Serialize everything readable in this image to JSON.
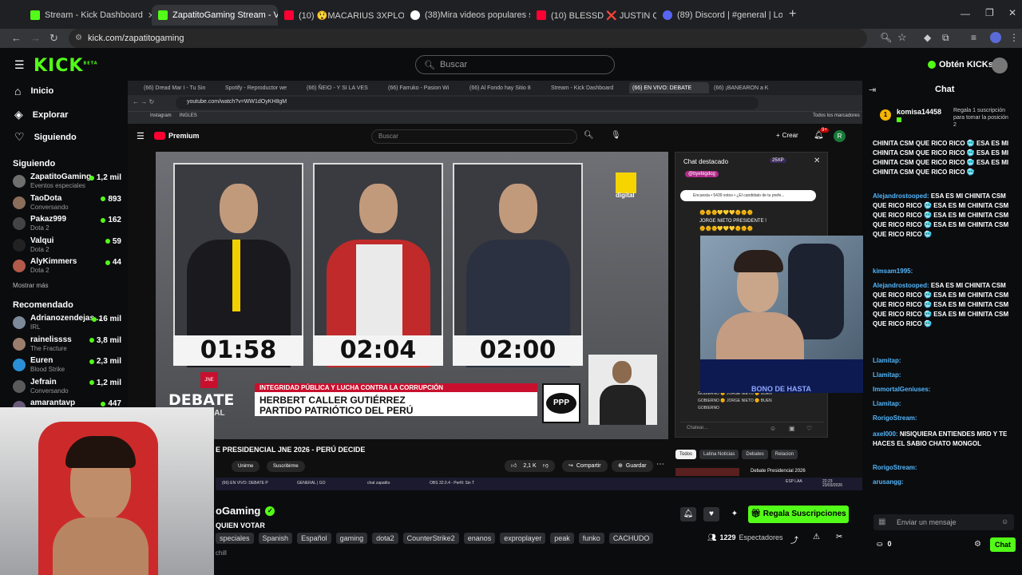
{
  "browser": {
    "tabs": [
      {
        "label": "Stream - Kick Dashboard",
        "color": "#53fc18"
      },
      {
        "label": "ZapatitoGaming Stream - V",
        "color": "#53fc18"
      },
      {
        "label": "(10) 😲MACARIUS 3XPLOTO y",
        "color": "#ff0033"
      },
      {
        "label": "(38)Mira videos populares sele",
        "color": "#ffffff"
      },
      {
        "label": "(10) BLESSD ❌ JUSTIN QUILES",
        "color": "#ff0033"
      },
      {
        "label": "(89) Discord | #general | Lo",
        "color": "#5865f2"
      }
    ],
    "new_tab": "+",
    "url": "kick.com/zapatitogaming"
  },
  "kick": {
    "logo": "KICK",
    "logo_sup": "BETA",
    "search_placeholder": "Buscar",
    "kicks_button": "Obtén KICKs",
    "nav": [
      {
        "label": "Inicio",
        "icon": "home-icon"
      },
      {
        "label": "Explorar",
        "icon": "compass-icon"
      },
      {
        "label": "Siguiendo",
        "icon": "heart-icon"
      }
    ],
    "following_header": "Siguiendo",
    "following": [
      {
        "name": "ZapatitoGaming",
        "sub": "Eventos especiales",
        "viewers": "1,2 mil",
        "color": "#6f6f6f"
      },
      {
        "name": "TaoDota",
        "sub": "Conversando",
        "viewers": "893",
        "color": "#8a6d5a"
      },
      {
        "name": "Pakaz999",
        "sub": "Dota 2",
        "viewers": "162",
        "color": "#444"
      },
      {
        "name": "Valqui",
        "sub": "Dota 2",
        "viewers": "59",
        "color": "#222"
      },
      {
        "name": "AlyKimmers",
        "sub": "Dota 2",
        "viewers": "44",
        "color": "#b45a4a"
      }
    ],
    "show_more": "Mostrar más",
    "recommended_header": "Recomendado",
    "recommended": [
      {
        "name": "Adrianozendejas...",
        "sub": "IRL",
        "viewers": "16 mil",
        "color": "#7d8a9a"
      },
      {
        "name": "rainelissss",
        "sub": "The Fracture",
        "viewers": "3,8 mil",
        "color": "#9a7d6a"
      },
      {
        "name": "Euren",
        "sub": "Blood Strike",
        "viewers": "2,3 mil",
        "color": "#2a8fd6"
      },
      {
        "name": "Jefrain",
        "sub": "Conversando",
        "viewers": "1,2 mil",
        "color": "#5a5a5a"
      },
      {
        "name": "amarantavp",
        "sub": "",
        "viewers": "447",
        "color": "#6a5a7a"
      }
    ],
    "stream": {
      "channel_partial": "oGaming",
      "title_partial": "QUIEN VOTAR",
      "tags": [
        "speciales",
        "Spanish",
        "Español",
        "gaming",
        "dota2",
        "CounterStrike2",
        "enanos",
        "exproplayer",
        "peak",
        "funko",
        "CACHUDO"
      ],
      "subs_button": "Regala Suscripciones",
      "viewers": "1229",
      "viewers_label": "Espectadores",
      "footer_partial": "chill"
    },
    "chat": {
      "title": "Chat",
      "pinned_user": "komisa14458",
      "pinned_text": "Regala 1 suscripción para tomar la posición 2",
      "pinned_rank": "1",
      "input_placeholder": "Enviar un mensaje",
      "count": "0",
      "send_button": "Chat",
      "messages": [
        {
          "user": "",
          "text": "CHINITA CSM QUE RICO RICO 🥶 ESA ES MI CHINITA CSM QUE RICO RICO 🥶 ESA ES MI CHINITA CSM QUE RICO RICO 🥶 ESA ES MI CHINITA CSM QUE RICO RICO 🥶"
        },
        {
          "user": "Alejandrostooped:",
          "text": "ESA ES MI CHINITA CSM QUE RICO RICO 🥶 ESA ES MI CHINITA CSM QUE RICO RICO 🥶 ESA ES MI CHINITA CSM QUE RICO RICO 🥶 ESA ES MI CHINITA CSM QUE RICO RICO 🥶"
        },
        {
          "user": "kimsam1995:",
          "text": ""
        },
        {
          "user": "Alejandrostooped:",
          "text": "ESA ES MI CHINITA CSM QUE RICO RICO 🥶 ESA ES MI CHINITA CSM QUE RICO RICO 🥶 ESA ES MI CHINITA CSM QUE RICO RICO 🥶 ESA ES MI CHINITA CSM QUE RICO RICO 🥶"
        },
        {
          "user": "Llamitap:",
          "text": ""
        },
        {
          "user": "Llamitap:",
          "text": ""
        },
        {
          "user": "ImmortalGeniuses:",
          "text": ""
        },
        {
          "user": "Llamitap:",
          "text": ""
        },
        {
          "user": "RorigoStream:",
          "text": ""
        },
        {
          "user": "axel000:",
          "text": "NISIQUIERA ENTIENDES MRD Y TE HACES EL SABIO CHATO MONGOL"
        },
        {
          "user": "RorigoStream:",
          "text": ""
        },
        {
          "user": "arusangg:",
          "text": ""
        }
      ]
    }
  },
  "inner": {
    "tabs": [
      "(66) Dread Mar I - Tu Sin",
      "Spotify - Reproductor we",
      "(66) ÑEIO - Y SI LA VES",
      "(66) Farruko - Pasion Wi",
      "(66) Al Fondo hay Sitio 8",
      "Stream - Kick Dashboard",
      "(66) EN VIVO: DEBATE",
      "(66) ¡BANEARON a K"
    ],
    "url": "youtube.com/watch?v=WW1dOyKH8gM",
    "bookmarks": [
      "Instagram",
      "INGLES"
    ],
    "all_bookmarks": "Todos los marcadores",
    "yt_search": "Buscar",
    "create": "Crear",
    "premium": "Premium",
    "notif_count": "9+",
    "video": {
      "times": [
        "01:58",
        "02:04",
        "02:00"
      ],
      "brand": "digital",
      "debate_label": "DEBATE",
      "debate_sub": "NCIAL",
      "banner_top": "INTEGRIDAD PÚBLICA Y LUCHA CONTRA LA CORRUPCIÓN",
      "banner_name": "HERBERT CALLER GUTIÉRREZ",
      "banner_party": "PARTIDO PATRIÓTICO DEL PERÚ",
      "party_logo": "PPP",
      "jne": "JNE"
    },
    "video_title": "E PRESIDENCIAL JNE 2026 - PERÚ DECIDE",
    "join": "Unirme",
    "subscribe": "Suscribirme",
    "likes": "2,1 K",
    "share": "Compartir",
    "save": "Guardar",
    "chat_header": "Chat destacado",
    "chat_badge": "25XP",
    "chat_user_tag": "@byebigdog",
    "poll": "Encuesta • 5439 votos • ¿El candidato de tu prefe...",
    "chat_placeholder": "Chatear...",
    "chips": [
      "Todos",
      "Latina Noticias",
      "Debates",
      "Relacion"
    ],
    "related": "Debate Presidencial 2026",
    "chat_lines": [
      "JORGE NIETO PRESIDENTE !",
      "GOBIERNO 🌞 JORGE NIETO 🌞 BUEN",
      "GOBIERNO 🌞 JORGE NIETO 🌞 BUEN",
      "GOBIERNO"
    ],
    "cam_overlay": "BONO DE HASTA",
    "taskbar": [
      "(66) EN VIVO: DEBATE P",
      "GENERAL | GO",
      "chat zapatito",
      "OBS 32.0.4 - Perfil: Sin T"
    ],
    "tray": [
      "ESP LAA",
      "22:23 23/03/2026"
    ]
  }
}
